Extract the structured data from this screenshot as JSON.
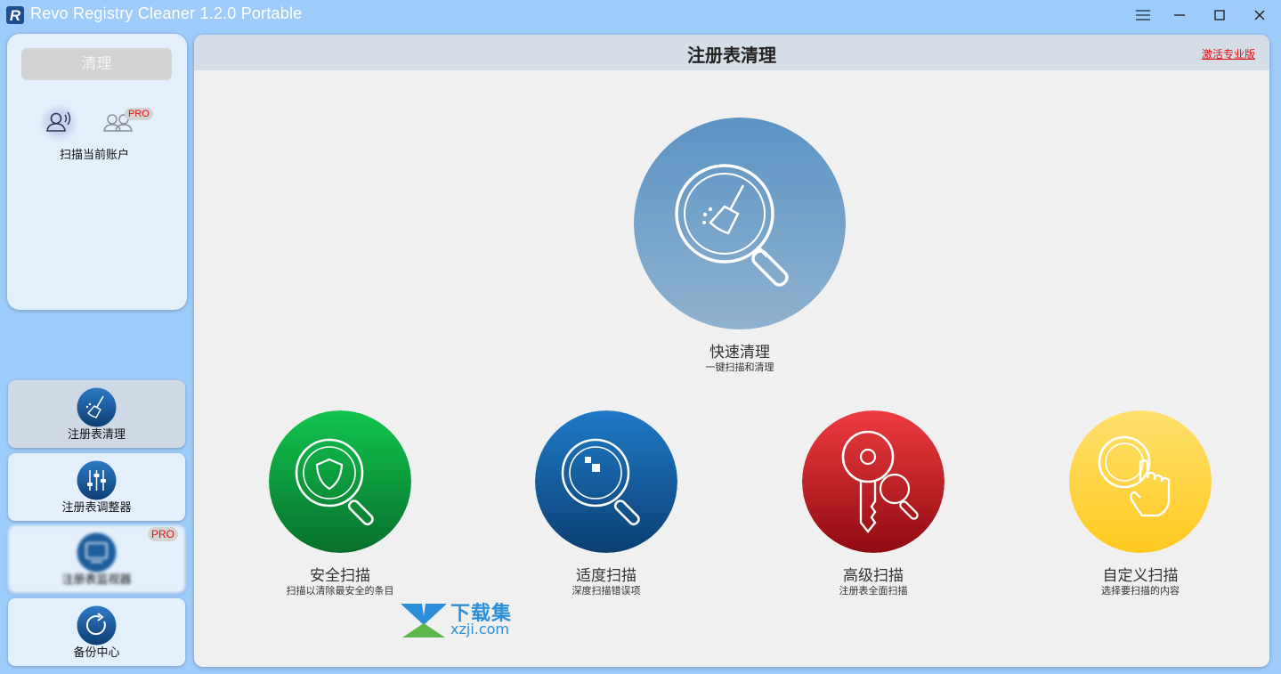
{
  "window": {
    "title": "Revo Registry Cleaner 1.2.0 Portable",
    "logo_letter": "R"
  },
  "left_panel": {
    "clean_button": "清理",
    "account_label": "扫描当前账户",
    "pro_badge": "PRO"
  },
  "nav": [
    {
      "label": "注册表清理",
      "icon": "broom-icon",
      "active": true
    },
    {
      "label": "注册表调整器",
      "icon": "sliders-icon",
      "active": false
    },
    {
      "label": "注册表监视器",
      "icon": "monitor-icon",
      "active": false,
      "pro": "PRO"
    },
    {
      "label": "备份中心",
      "icon": "backup-refresh-icon",
      "active": false
    }
  ],
  "main": {
    "title": "注册表清理",
    "activate_link": "激活专业版",
    "quick_clean": {
      "title": "快速清理",
      "subtitle": "一键扫描和清理"
    },
    "scans": [
      {
        "title": "安全扫描",
        "subtitle": "扫描以清除最安全的条目",
        "color": "#0a9a3c"
      },
      {
        "title": "适度扫描",
        "subtitle": "深度扫描错误项",
        "color": "#155e9f"
      },
      {
        "title": "高级扫描",
        "subtitle": "注册表全面扫描",
        "color": "#c8141c"
      },
      {
        "title": "自定义扫描",
        "subtitle": "选择要扫描的内容",
        "color": "#ffd23a"
      }
    ]
  },
  "watermark": {
    "cn": "下载集",
    "domain": "xzji.com"
  }
}
